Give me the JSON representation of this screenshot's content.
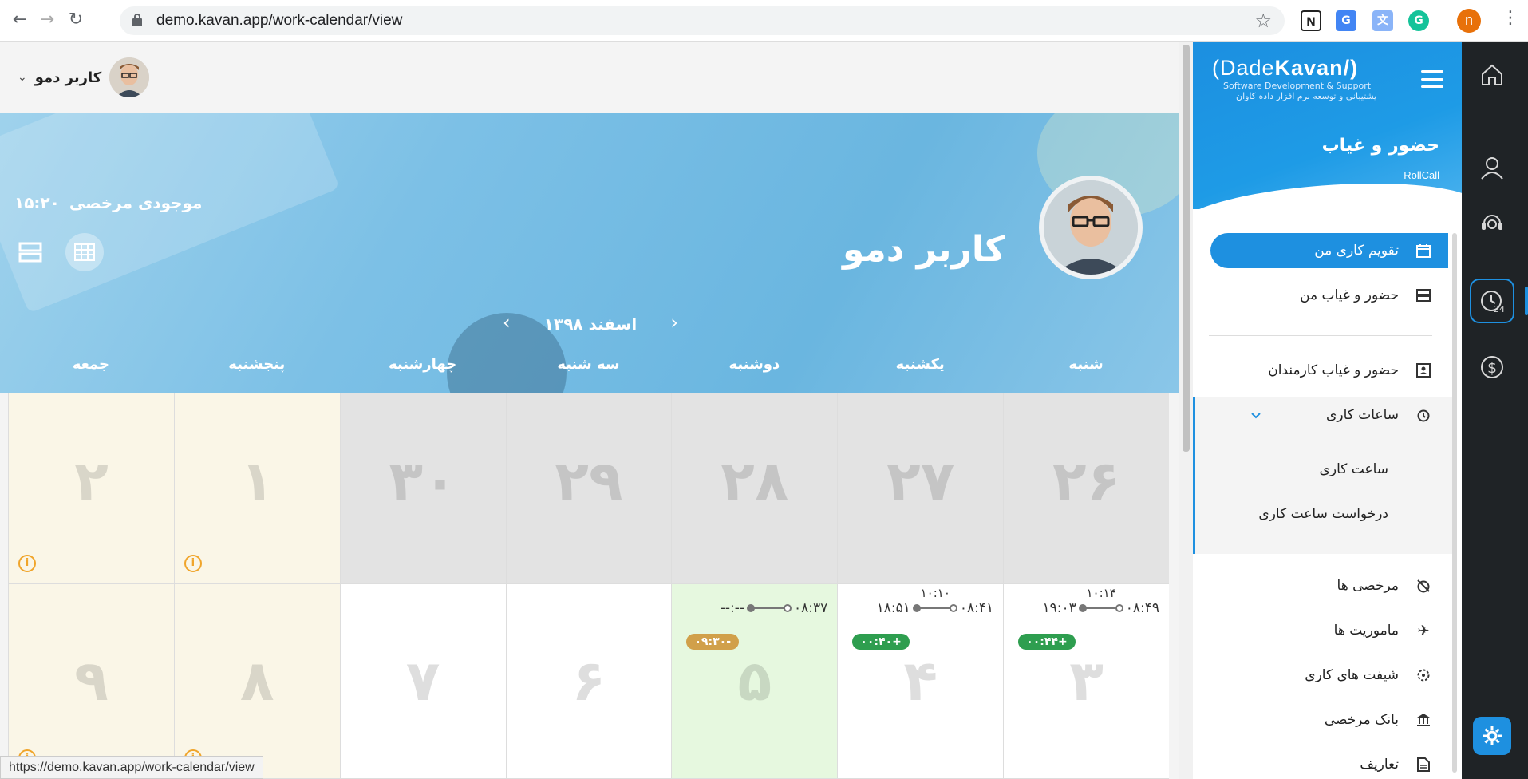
{
  "browser": {
    "url": "demo.kavan.app/work-calendar/view",
    "status_url": "https://demo.kavan.app/work-calendar/view",
    "profile_initial": "n"
  },
  "topbar": {
    "user_name": "کاربر دمو"
  },
  "hero": {
    "leave_label": "موجودی مرخصی",
    "leave_value": "۱۵:۲۰",
    "user_name": "کاربر دمو",
    "month_title": "اسفند ۱۳۹۸"
  },
  "calendar": {
    "weekdays": [
      "شنبه",
      "یکشنبه",
      "دوشنبه",
      "سه شنبه",
      "چهارشنبه",
      "پنجشنبه",
      "جمعه"
    ],
    "rows": [
      [
        {
          "day": "۲۶",
          "type": "prev"
        },
        {
          "day": "۲۷",
          "type": "prev"
        },
        {
          "day": "۲۸",
          "type": "prev"
        },
        {
          "day": "۲۹",
          "type": "prev"
        },
        {
          "day": "۳۰",
          "type": "prev"
        },
        {
          "day": "۱",
          "type": "weekend",
          "info": "i"
        },
        {
          "day": "۲",
          "type": "weekend",
          "info": "i"
        }
      ],
      [
        {
          "day": "۳",
          "type": "normal",
          "in": "۰۸:۴۹",
          "mid": "۱۰:۱۴",
          "out": "۱۹:۰۳",
          "badge": "+۰۰:۴۴",
          "badge_color": "green"
        },
        {
          "day": "۴",
          "type": "normal",
          "in": "۰۸:۴۱",
          "mid": "۱۰:۱۰",
          "out": "۱۸:۵۱",
          "badge": "+۰۰:۴۰",
          "badge_color": "green"
        },
        {
          "day": "۵",
          "type": "today",
          "in": "۰۸:۳۷",
          "mid": "",
          "out": "--:--",
          "badge": "-۰۹:۳۰",
          "badge_color": "orange"
        },
        {
          "day": "۶",
          "type": "normal"
        },
        {
          "day": "۷",
          "type": "normal"
        },
        {
          "day": "۸",
          "type": "weekend",
          "info": "i"
        },
        {
          "day": "۹",
          "type": "weekend",
          "info": "i"
        }
      ]
    ]
  },
  "sidebar": {
    "logo_brand_a": "(Dade",
    "logo_brand_b": "Kavan/)",
    "logo_tag": "Software Development & Support",
    "logo_tag_fa": "پشتیبانی و توسعه نرم افزار داده کاوان",
    "module_title": "حضور و غیاب",
    "module_sub": "RollCall",
    "items": [
      {
        "label": "تقویم کاری من",
        "icon": "calendar-icon"
      },
      {
        "label": "حضور و غیاب من",
        "icon": "list-icon"
      },
      {
        "label": "حضور و غیاب کارمندان",
        "icon": "id-card-icon"
      },
      {
        "label": "ساعات کاری",
        "icon": "alarm-icon"
      },
      {
        "label": "ساعت کاری"
      },
      {
        "label": "درخواست ساعت کاری"
      },
      {
        "label": "مرخصی ها",
        "icon": "alarm-off-icon"
      },
      {
        "label": "ماموریت ها",
        "icon": "airplane-icon"
      },
      {
        "label": "شیفت های کاری",
        "icon": "shift-icon"
      },
      {
        "label": "بانک مرخصی",
        "icon": "bank-icon"
      },
      {
        "label": "تعاریف",
        "icon": "document-icon"
      }
    ]
  },
  "rail": {
    "items": [
      "home-icon",
      "user-icon",
      "support-icon",
      "clock-24-icon",
      "dollar-icon",
      "settings-icon"
    ]
  },
  "colors": {
    "accent": "#1e90e0",
    "rail_bg": "#1f2326",
    "badge_green": "#2e9e4f",
    "badge_orange": "#d1a04a",
    "info_orange": "#f0a52b"
  }
}
